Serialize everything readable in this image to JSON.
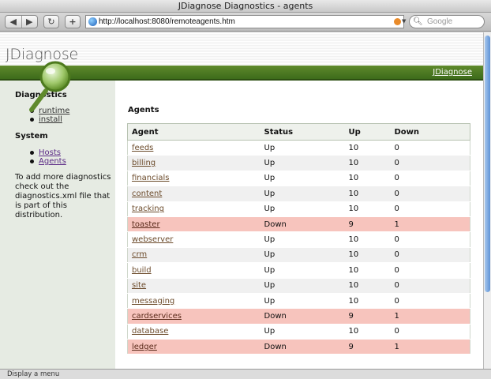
{
  "window": {
    "title": "JDiagnose Diagnostics - agents",
    "back_label": "◀",
    "forward_label": "▶",
    "reload_label": "↻",
    "newtab_label": "+",
    "url": "http://localhost:8080/remoteagents.htm",
    "search_placeholder": "Google",
    "status": "Display a menu"
  },
  "header": {
    "logo": "JDiagnose",
    "top_link": "JDiagnose",
    "bar_color": "#4a7a22"
  },
  "sidebar": {
    "diagnostics_heading": "Diagnostics",
    "diagnostics_items": [
      "runtime",
      "install"
    ],
    "system_heading": "System",
    "system_items": [
      "Hosts",
      "Agents"
    ],
    "note": "To add more diagnostics check out the diagnostics.xml file that is part of this distribution."
  },
  "main": {
    "title": "Agents",
    "columns": [
      "Agent",
      "Status",
      "Up",
      "Down"
    ],
    "rows": [
      {
        "agent": "feeds",
        "status": "Up",
        "up": "10",
        "down": "0"
      },
      {
        "agent": "billing",
        "status": "Up",
        "up": "10",
        "down": "0"
      },
      {
        "agent": "financials",
        "status": "Up",
        "up": "10",
        "down": "0"
      },
      {
        "agent": "content",
        "status": "Up",
        "up": "10",
        "down": "0"
      },
      {
        "agent": "tracking",
        "status": "Up",
        "up": "10",
        "down": "0"
      },
      {
        "agent": "toaster",
        "status": "Down",
        "up": "9",
        "down": "1"
      },
      {
        "agent": "webserver",
        "status": "Up",
        "up": "10",
        "down": "0"
      },
      {
        "agent": "crm",
        "status": "Up",
        "up": "10",
        "down": "0"
      },
      {
        "agent": "build",
        "status": "Up",
        "up": "10",
        "down": "0"
      },
      {
        "agent": "site",
        "status": "Up",
        "up": "10",
        "down": "0"
      },
      {
        "agent": "messaging",
        "status": "Up",
        "up": "10",
        "down": "0"
      },
      {
        "agent": "cardservices",
        "status": "Down",
        "up": "9",
        "down": "1"
      },
      {
        "agent": "database",
        "status": "Up",
        "up": "10",
        "down": "0"
      },
      {
        "agent": "ledger",
        "status": "Down",
        "up": "9",
        "down": "1"
      }
    ]
  },
  "colors": {
    "down_row": "#f7c4bd",
    "sidebar_bg": "#e6ebe3"
  }
}
